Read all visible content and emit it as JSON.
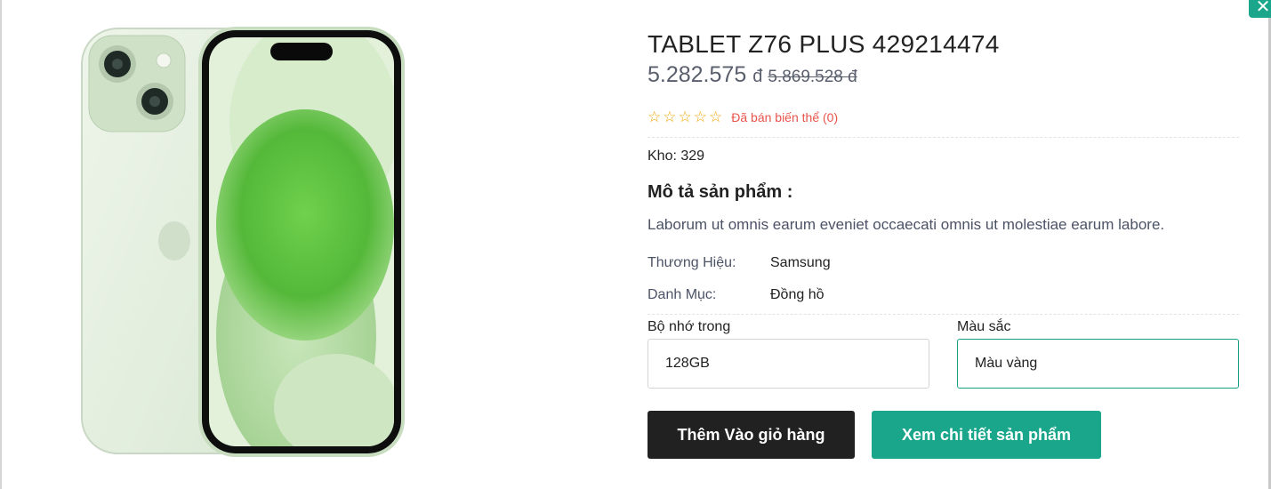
{
  "close_icon": "close-icon",
  "product": {
    "title": "TABLET Z76 PLUS 429214474",
    "price": "5.282.575",
    "currency": "đ",
    "old_price": "5.869.528 đ",
    "rating": 0,
    "rating_max": 5,
    "sold_text": "Đã bán biến thể (0)",
    "stock_text": "Kho: 329",
    "description_title": "Mô tả sản phẩm :",
    "description": "Laborum ut omnis earum eveniet occaecati omnis ut molestiae earum labore.",
    "attributes": [
      {
        "label": "Thương Hiệu:",
        "value": "Samsung"
      },
      {
        "label": "Danh Mục:",
        "value": "Đồng hồ"
      }
    ]
  },
  "options": {
    "storage": {
      "label": "Bộ nhớ trong",
      "selected": "128GB"
    },
    "color": {
      "label": "Màu sắc",
      "selected": "Màu vàng"
    }
  },
  "actions": {
    "add_to_cart": "Thêm Vào giỏ hàng",
    "view_details": "Xem chi tiết sản phẩm"
  },
  "colors": {
    "accent": "#19a68a",
    "dark_button": "#212121",
    "sold_text": "#e9544a",
    "star": "#f0a400"
  }
}
